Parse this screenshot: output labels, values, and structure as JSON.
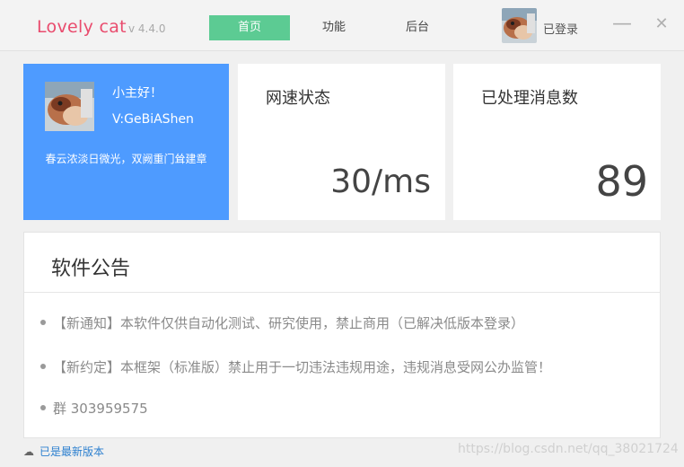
{
  "header": {
    "app_title": "Lovely cat",
    "version": "v 4.4.0",
    "tabs": [
      {
        "label": "首页",
        "active": true
      },
      {
        "label": "功能",
        "active": false
      },
      {
        "label": "后台",
        "active": false
      }
    ],
    "login_status": "已登录",
    "minimize_glyph": "—",
    "close_glyph": "✕"
  },
  "profile": {
    "greeting": "小主好！",
    "wechat_id": "V:GeBiAShen",
    "motto": "春云浓淡日微光，双阙重门耸建章"
  },
  "stats": {
    "speed_label": "网速状态",
    "speed_value": "30/ms",
    "messages_label": "已处理消息数",
    "messages_value": "89"
  },
  "notice": {
    "title": "软件公告",
    "items": [
      "【新通知】本软件仅供自动化测试、研究使用，禁止商用（已解决低版本登录）",
      "【新约定】本框架（标准版）禁止用于一切违法违规用途，违规消息受网公办监管！",
      "群 303959575"
    ]
  },
  "footer": {
    "status": "已是最新版本",
    "cloud_icon": "☁"
  },
  "watermark": "https://blog.csdn.net/qq_38021724",
  "colors": {
    "accent": "#e94b6d",
    "active_tab": "#5ccb93",
    "profile_bg": "#4e9bff",
    "link": "#2b7fcf"
  }
}
